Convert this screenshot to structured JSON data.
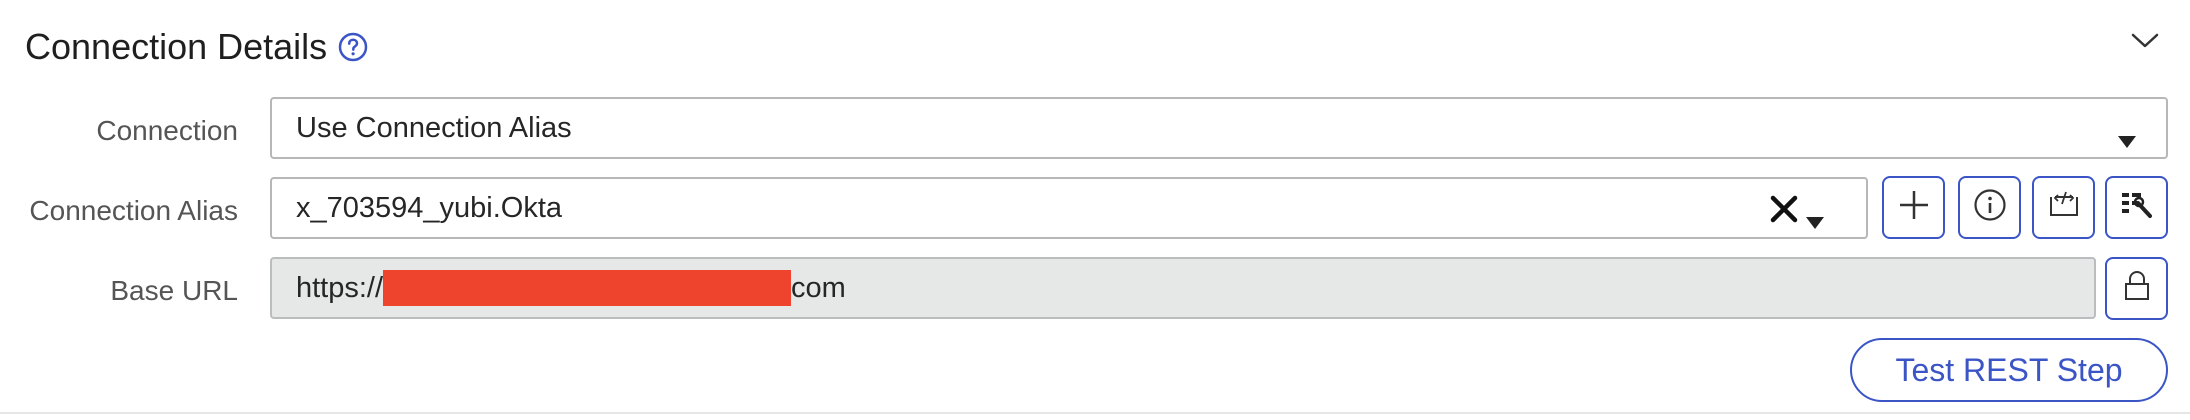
{
  "section": {
    "title": "Connection Details"
  },
  "connection": {
    "label": "Connection",
    "value": "Use Connection Alias"
  },
  "alias": {
    "label": "Connection Alias",
    "value": "x_703594_yubi.Okta"
  },
  "base_url": {
    "label": "Base URL",
    "prefix": "https://",
    "suffix": "com"
  },
  "test_button": {
    "label": "Test REST Step"
  },
  "icons": {
    "help": "help-icon",
    "collapse": "chevron-down-icon",
    "clear": "close-icon",
    "dropdown": "caret-down-icon",
    "add": "plus-icon",
    "info": "info-icon",
    "script": "script-icon",
    "tools": "tools-icon",
    "lock": "lock-icon"
  },
  "colors": {
    "accent": "#3b55c7",
    "redaction": "#ee432c",
    "readonly_bg": "#e6e8e8"
  }
}
